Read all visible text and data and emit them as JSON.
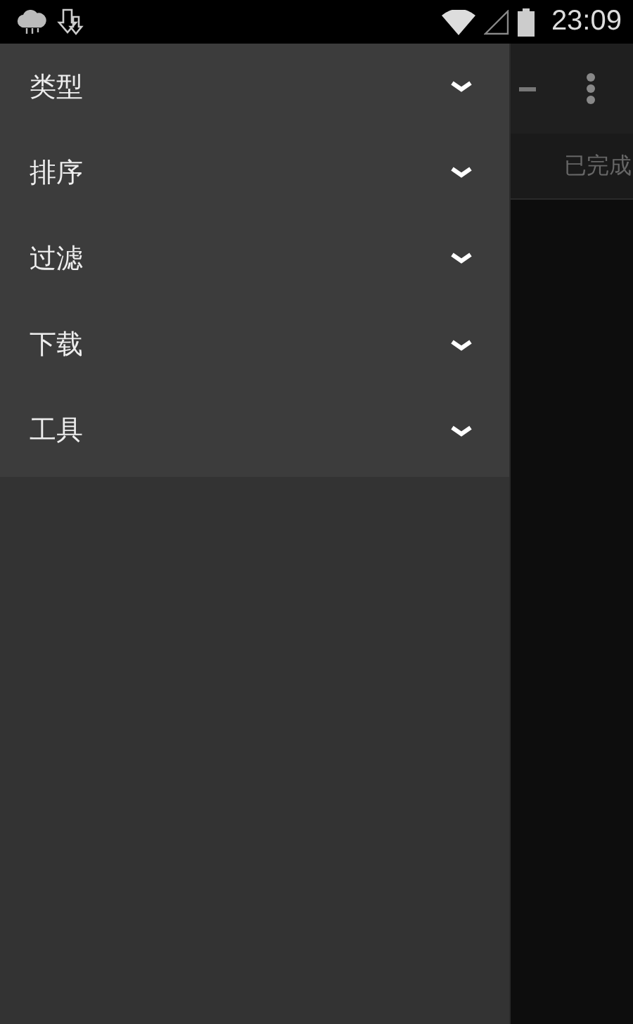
{
  "status_bar": {
    "time": "23:09"
  },
  "app": {
    "tab": "已完成"
  },
  "drawer": {
    "items": [
      {
        "label": "类型",
        "expanded": false
      },
      {
        "label": "排序",
        "expanded": false
      },
      {
        "label": "过滤",
        "expanded": false
      },
      {
        "label": "下载",
        "expanded": false
      },
      {
        "label": "工具",
        "expanded": false
      }
    ]
  }
}
